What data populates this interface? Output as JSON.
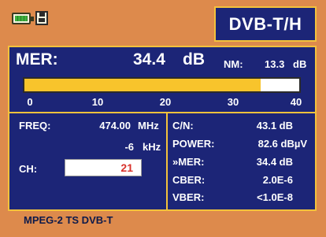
{
  "header": {
    "standard": "DVB-T/H",
    "battery_icon": "battery-icon",
    "storage_icon": "floppy-disk-icon"
  },
  "mer": {
    "label": "MER:",
    "value": "34.4",
    "unit": "dB",
    "nm_label": "NM:",
    "nm_value": "13.3",
    "nm_unit": "dB",
    "scale_min": 0,
    "scale_max": 40,
    "bar_level": 34.4,
    "ticks": [
      "0",
      "10",
      "20",
      "30",
      "40"
    ]
  },
  "tuning": {
    "freq_label": "FREQ:",
    "freq_value": "474.00",
    "freq_unit": "MHz",
    "offset_value": "-6",
    "offset_unit": "kHz",
    "ch_label": "CH:",
    "ch_value": "21"
  },
  "measures": {
    "cn_label": "C/N:",
    "cn_value": "43.1 dB",
    "power_label": "POWER:",
    "power_value": "82.6 dBµV",
    "mer_label": "»MER:",
    "mer_value": "34.4 dB",
    "cber_label": "CBER:",
    "cber_value": "2.0E-6",
    "vber_label": "VBER:",
    "vber_value": "<1.0E-8"
  },
  "footer": {
    "status": "MPEG-2 TS DVB-T"
  },
  "colors": {
    "background": "#dd8a4c",
    "panel": "#1c2577",
    "border": "#f3c23c",
    "bar_fill": "#f8c42c",
    "channel_text": "#d8322b"
  }
}
